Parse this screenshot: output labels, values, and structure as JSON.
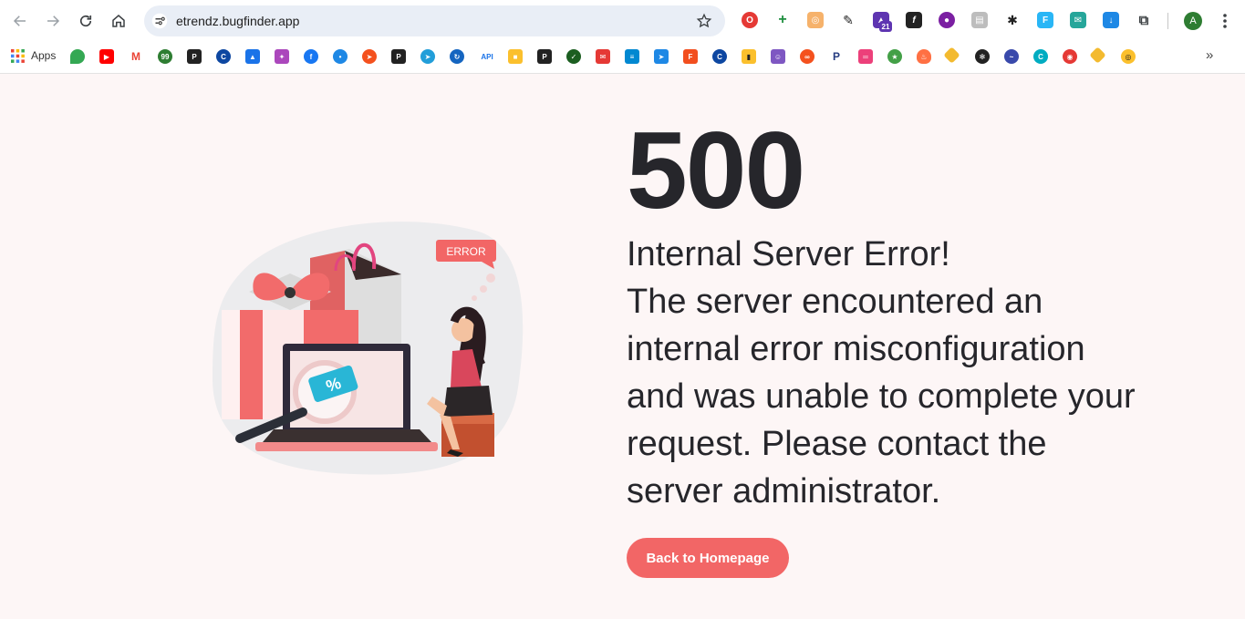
{
  "browser": {
    "url": "etrendz.bugfinder.app",
    "avatar_letter": "A",
    "extension_badge": "21",
    "bookmarks_apps_label": "Apps",
    "bookmark_api_label": "API",
    "more_bookmarks_glyph": "»"
  },
  "illustration": {
    "error_tag": "ERROR",
    "discount_symbol": "%"
  },
  "error": {
    "code": "500",
    "title": "Internal Server Error!",
    "message": "The server encountered an internal error misconfiguration and was unable to complete your request. Please contact the server administrator.",
    "button_label": "Back to Homepage"
  },
  "colors": {
    "accent": "#f26666",
    "page_background": "#fdf6f6",
    "text": "#26262b"
  }
}
